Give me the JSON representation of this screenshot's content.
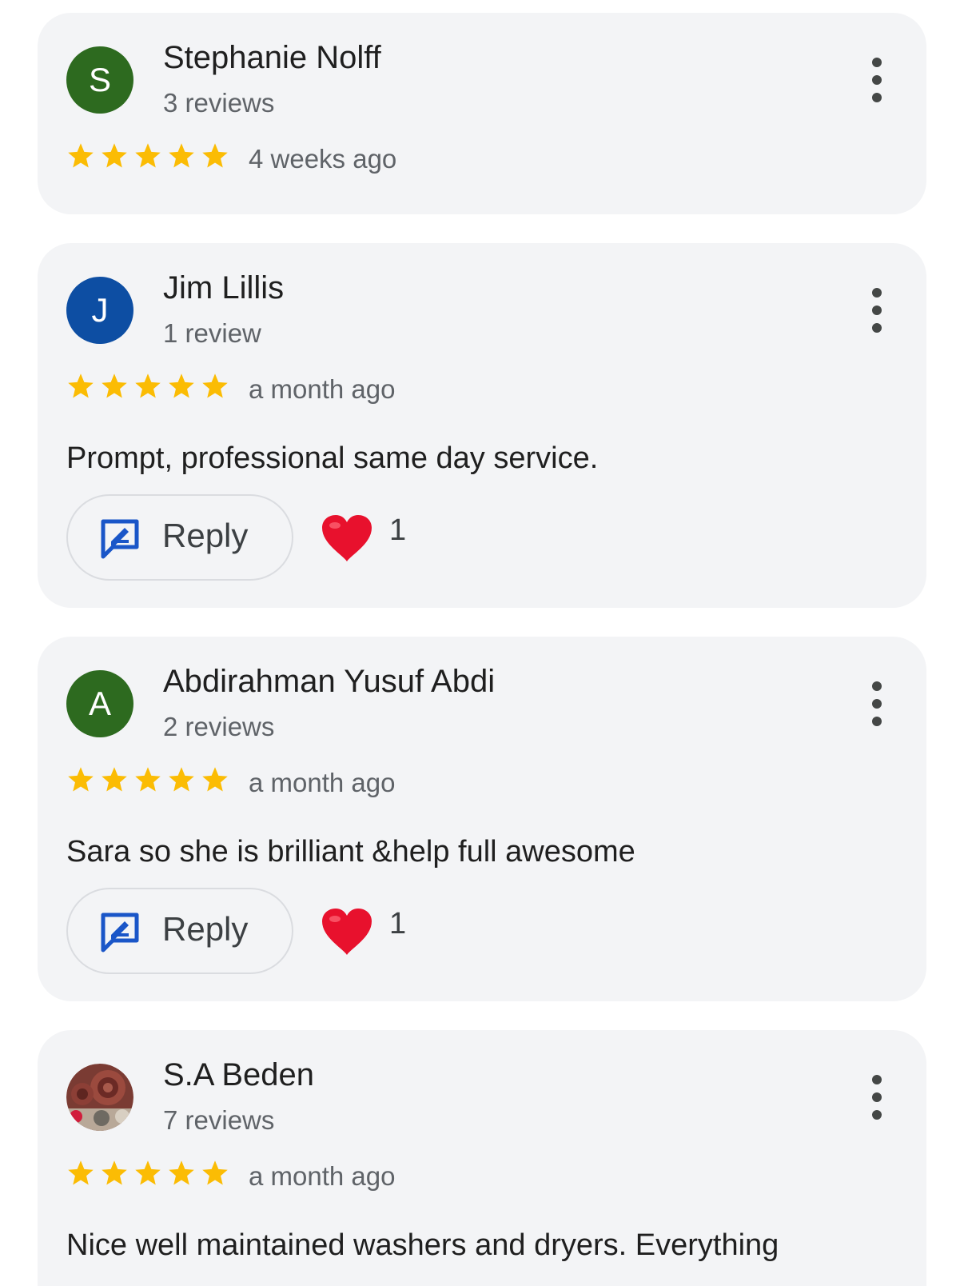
{
  "colors": {
    "card_background": "#f3f4f6",
    "star": "#fbbc04",
    "heart": "#e8112d",
    "reply_icon": "#1a56c8",
    "avatar_s": "#2d6a1f",
    "avatar_j": "#0d4ea3",
    "avatar_a": "#2d6a1f"
  },
  "icons": {
    "menu": "more-vertical-icon",
    "star": "star-icon",
    "reply": "reply-edit-icon",
    "like": "heart-icon"
  },
  "reviews": [
    {
      "avatar_letter": "S",
      "name": "Stephanie Nolff",
      "review_count": "3 reviews",
      "rating": 5,
      "time": "4 weeks ago"
    },
    {
      "avatar_letter": "J",
      "name": "Jim Lillis",
      "review_count": "1 review",
      "rating": 5,
      "time": "a month ago",
      "text": "Prompt, professional same day service.",
      "reply_label": "Reply",
      "likes": "1"
    },
    {
      "avatar_letter": "A",
      "name": "Abdirahman Yusuf Abdi",
      "review_count": "2 reviews",
      "rating": 5,
      "time": "a month ago",
      "text": "Sara so she is brilliant &help full awesome",
      "reply_label": "Reply",
      "likes": "1"
    },
    {
      "avatar_letter": "",
      "name": "S.A Beden",
      "review_count": "7 reviews",
      "rating": 5,
      "time": "a month ago",
      "text": "Nice well maintained washers and dryers. Everything"
    }
  ]
}
